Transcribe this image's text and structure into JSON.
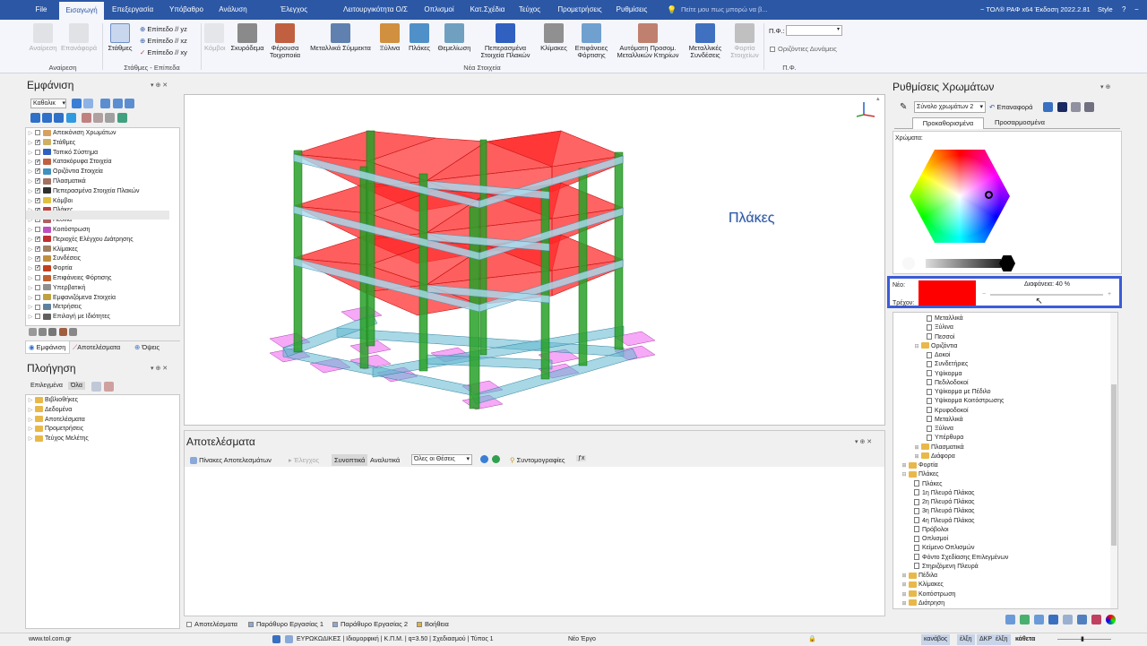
{
  "titlebar": {
    "tabs": [
      "File",
      "Εισαγωγή",
      "Επεξεργασία",
      "Υπόβαθρο",
      "Ανάλυση",
      "Έλεγχος Επάρκειας",
      "Λειτουργικότητα Ο/Σ",
      "Οπλισμοί",
      "Κατ.Σχέδια",
      "Τεύχος",
      "Προμετρήσεις",
      "Ρυθμίσεις"
    ],
    "active_tab": "Εισαγωγή",
    "search_placeholder": "Πείτε μου πως μπορώ να β...",
    "app_title": "~ ΤΟΛ® ΡΑΦ x64 Έκδοση 2022.2.81",
    "style_label": "Style"
  },
  "ribbon": {
    "undo": "Αναίρεση",
    "redo": "Επανάφορά",
    "group_undo": "Αναίρεση",
    "levels": "Στάθμες",
    "level_items": [
      "Επίπεδο // yz",
      "Επίπεδο // xz",
      "Επίπεδο // xy"
    ],
    "group_levels": "Στάθμες - Επίπεδα",
    "kmvoi": "Κόμβοι",
    "items": [
      "Σκυρόδεμα",
      "Φέρουσα Τοιχοποιία",
      "Μεταλλικά Σύμμεκτα",
      "Ξύλινα",
      "Πλάκες",
      "Θεμελίωση",
      "Πεπερασμένα Στοιχεία Πλακών",
      "Κλίμακες",
      "Επιφάνειες Φόρτισης",
      "Αυτόματη Προσομ. Μεταλλικών Κτηρίων",
      "Μεταλλικές Συνδέσεις",
      "Φορτία Στοιχείων"
    ],
    "group_new": "Νέα Στοιχεία",
    "pf_label": "Π.Φ.:",
    "horizontal_forces": "Οριζόντιες Δυνάμεις",
    "group_pf": "Π.Φ."
  },
  "appearance": {
    "title": "Εμφάνιση",
    "dropdown": "Καθολικ",
    "items": [
      {
        "label": "Απεικόνιση Χρωμάτων",
        "checked": false,
        "color": "#d8a060"
      },
      {
        "label": "Στάθμες",
        "checked": true,
        "color": "#d0b060"
      },
      {
        "label": "Τοπικό Σύστημα",
        "checked": false,
        "color": "#3060c0"
      },
      {
        "label": "Κατακόρυφα Στοιχεία",
        "checked": true,
        "color": "#c06040"
      },
      {
        "label": "Οριζόντια Στοιχεία",
        "checked": true,
        "color": "#4090c0"
      },
      {
        "label": "Πλασματικά",
        "checked": true,
        "color": "#a07060"
      },
      {
        "label": "Πεπερασμένα Στοιχεία Πλακών",
        "checked": true,
        "color": "#303030"
      },
      {
        "label": "Κόμβοι",
        "checked": true,
        "color": "#e0c040"
      },
      {
        "label": "Πλάκες",
        "checked": true,
        "color": "#c04040"
      },
      {
        "label": "Πέδιλα",
        "checked": true,
        "color": "#b06060"
      },
      {
        "label": "Κοιτόστρωση",
        "checked": false,
        "color": "#c050c0"
      },
      {
        "label": "Περιοχές Ελέγχου Διάτρησης",
        "checked": true,
        "color": "#c03030"
      },
      {
        "label": "Κλίμακες",
        "checked": true,
        "color": "#a08060"
      },
      {
        "label": "Συνδέσεις",
        "checked": true,
        "color": "#c09040"
      },
      {
        "label": "Φορτία",
        "checked": true,
        "color": "#c04020"
      },
      {
        "label": "Επιφάνειες Φόρτισης",
        "checked": false,
        "color": "#c06030"
      },
      {
        "label": "Υπερβατική",
        "checked": false,
        "color": "#909090"
      },
      {
        "label": "Εμφανιζόμενα Στοιχεία",
        "checked": false,
        "color": "#c0a040"
      },
      {
        "label": "Μετρήσεις",
        "checked": false,
        "color": "#6080a0"
      },
      {
        "label": "Επιλογή με Ιδιότητες",
        "checked": false,
        "color": "#606060"
      }
    ],
    "tabs": [
      "Εμφάνιση",
      "Αποτελέσματα",
      "Όψεις"
    ]
  },
  "navigation": {
    "title": "Πλοήγηση",
    "filter_left": "Επιλεγμένα",
    "filter_right": "Όλα",
    "items": [
      "Βιβλιοθήκες",
      "Δεδομένα",
      "Αποτελέσματα",
      "Προμετρήσεις",
      "Τεύχος Μελέτης"
    ]
  },
  "viewport": {
    "label": "Πλάκες"
  },
  "results": {
    "title": "Αποτελέσματα",
    "toolbar": [
      "Πίνακες Αποτελεσμάτων",
      "Έλεγχος",
      "Συνοπτικά",
      "Αναλυτικά"
    ],
    "dropdown": "Όλες οι Θέσεις",
    "shortcuts": "Συντομογραφίες"
  },
  "bottom_tabs": [
    "Αποτελέσματα",
    "Παράθυρο Εργασίας 1",
    "Παράθυρο Εργασίας 2",
    "Βοήθεια"
  ],
  "colors": {
    "title": "Ρυθμίσεις Χρωμάτων",
    "preset": "Σύνολο χρωμάτων 2",
    "restore": "Επαναφορά",
    "tabs": [
      "Προκαθορισμένα",
      "Προσαρμοσμένα"
    ],
    "colors_label": "Χρώματα:",
    "new_label": "Νέο:",
    "current_label": "Τρέχον:",
    "transparency": "Διαφάνεια: 40 %",
    "new_color": "#ff0000",
    "transparency_value": 40
  },
  "color_tree": [
    {
      "label": "Μεταλλικά",
      "indent": 5,
      "type": "file"
    },
    {
      "label": "Ξύλινα",
      "indent": 5,
      "type": "file"
    },
    {
      "label": "Πεσσοί",
      "indent": 5,
      "type": "file"
    },
    {
      "label": "Οριζόντια",
      "indent": 3,
      "type": "folder",
      "exp": "−"
    },
    {
      "label": "Δοκοί",
      "indent": 5,
      "type": "file"
    },
    {
      "label": "Συνδετήριες",
      "indent": 5,
      "type": "file"
    },
    {
      "label": "Υψίκορμα",
      "indent": 5,
      "type": "file"
    },
    {
      "label": "Πεδιλοδοκοί",
      "indent": 5,
      "type": "file"
    },
    {
      "label": "Υψίκορμα με Πέδιλο",
      "indent": 5,
      "type": "file"
    },
    {
      "label": "Υψίκορμα Κοιτόστρωσης",
      "indent": 5,
      "type": "file"
    },
    {
      "label": "Κρυφοδοκοί",
      "indent": 5,
      "type": "file"
    },
    {
      "label": "Μεταλλικά",
      "indent": 5,
      "type": "file"
    },
    {
      "label": "Ξύλινα",
      "indent": 5,
      "type": "file"
    },
    {
      "label": "Υπέρθυρα",
      "indent": 5,
      "type": "file"
    },
    {
      "label": "Πλασματικά",
      "indent": 3,
      "type": "folder",
      "exp": "+"
    },
    {
      "label": "Διάφορα",
      "indent": 3,
      "type": "folder",
      "exp": "+"
    },
    {
      "label": "Φορτία",
      "indent": 1,
      "type": "folder",
      "exp": "+"
    },
    {
      "label": "Πλάκες",
      "indent": 1,
      "type": "folder",
      "exp": "−"
    },
    {
      "label": "Πλάκες",
      "indent": 3,
      "type": "file"
    },
    {
      "label": "1η Πλευρά Πλάκας",
      "indent": 3,
      "type": "file"
    },
    {
      "label": "2η Πλευρά Πλάκας",
      "indent": 3,
      "type": "file"
    },
    {
      "label": "3η Πλευρά Πλάκας",
      "indent": 3,
      "type": "file"
    },
    {
      "label": "4η Πλευρά Πλάκας",
      "indent": 3,
      "type": "file"
    },
    {
      "label": "Πρόβολοι",
      "indent": 3,
      "type": "file"
    },
    {
      "label": "Οπλισμοί",
      "indent": 3,
      "type": "file"
    },
    {
      "label": "Κείμενο Οπλισμών",
      "indent": 3,
      "type": "file"
    },
    {
      "label": "Φόντο Σχεδίασης Επιλεγμένων",
      "indent": 3,
      "type": "file"
    },
    {
      "label": "Στηριζόμενη Πλευρά",
      "indent": 3,
      "type": "file"
    },
    {
      "label": "Πέδιλα",
      "indent": 1,
      "type": "folder",
      "exp": "+"
    },
    {
      "label": "Κλίμακες",
      "indent": 1,
      "type": "folder",
      "exp": "+"
    },
    {
      "label": "Κοιτόστρωση",
      "indent": 1,
      "type": "folder",
      "exp": "+"
    },
    {
      "label": "Διάτρηση",
      "indent": 1,
      "type": "folder",
      "exp": "+"
    }
  ],
  "status": {
    "website": "www.tol.com.gr",
    "info": "ΕΥΡΩΚΩΔΙΚΕΣ | Ιδιομορφική | Κ.Π.Μ. | q=3.50 | Σχεδιασμού | Τύπος 1",
    "project": "Νέο Έργο",
    "snap": [
      "κανάβος",
      "έλξη",
      "ΔΚΡ",
      "έλξη",
      "κάθετα"
    ]
  }
}
